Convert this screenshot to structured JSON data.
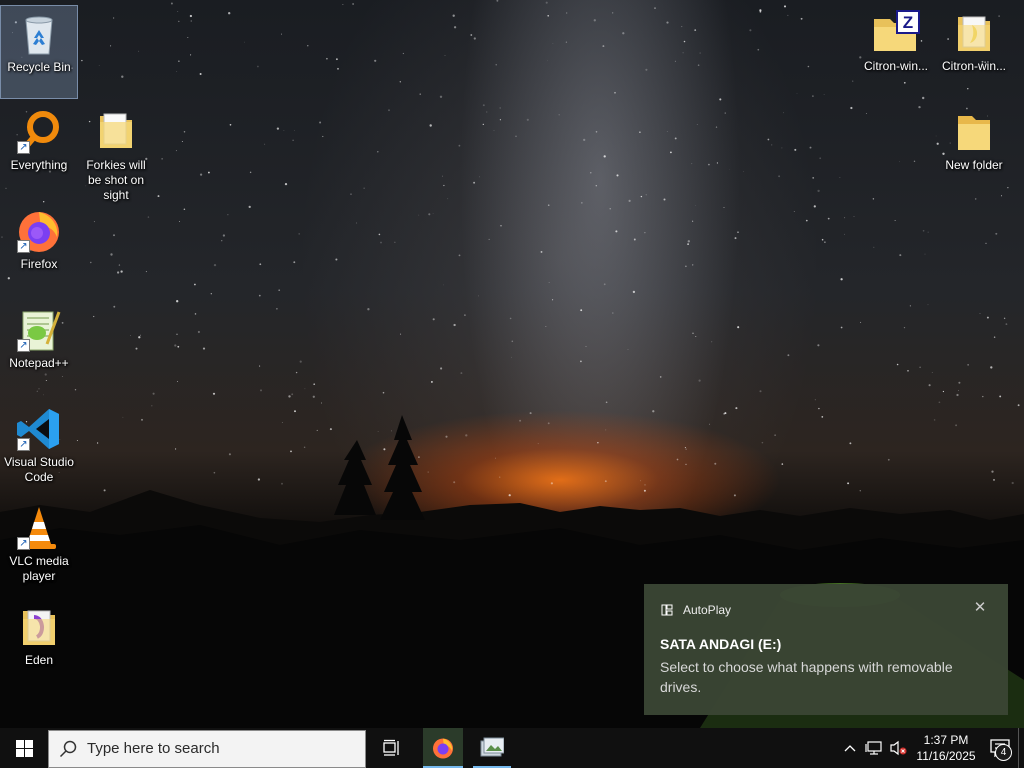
{
  "desktop": {
    "icons_left": [
      {
        "id": "recycle-bin",
        "label": "Recycle Bin",
        "icon": "recycle-bin-icon",
        "shortcut": false,
        "selected": true
      },
      {
        "id": "everything",
        "label": "Everything",
        "icon": "magnifier-icon",
        "shortcut": true
      },
      {
        "id": "forkies",
        "label": "Forkies will be shot on sight",
        "icon": "folder-icon",
        "shortcut": false
      },
      {
        "id": "firefox",
        "label": "Firefox",
        "icon": "firefox-icon",
        "shortcut": true
      },
      {
        "id": "notepadpp",
        "label": "Notepad++",
        "icon": "notepadpp-icon",
        "shortcut": true
      },
      {
        "id": "vscode",
        "label": "Visual Studio Code",
        "icon": "vscode-icon",
        "shortcut": true
      },
      {
        "id": "vlc",
        "label": "VLC media player",
        "icon": "vlc-cone-icon",
        "shortcut": true
      },
      {
        "id": "eden",
        "label": "Eden",
        "icon": "folder-icon",
        "shortcut": false
      }
    ],
    "icons_right": [
      {
        "id": "citron-1",
        "label": "Citron-win...",
        "icon": "zip-folder-icon"
      },
      {
        "id": "citron-2",
        "label": "Citron-win...",
        "icon": "folder-icon"
      },
      {
        "id": "new-folder",
        "label": "New folder",
        "icon": "folder-icon"
      }
    ]
  },
  "toast": {
    "app_name": "AutoPlay",
    "title": "SATA ANDAGI (E:)",
    "body": "Select to choose what happens with removable drives.",
    "close_glyph": "✕"
  },
  "taskbar": {
    "search_placeholder": "Type here to search",
    "pinned": [
      {
        "id": "task-view",
        "icon": "task-view-icon"
      },
      {
        "id": "firefox",
        "icon": "firefox-icon",
        "active": true
      },
      {
        "id": "file-explorer",
        "icon": "image-viewer-icon",
        "running": true
      }
    ],
    "clock": {
      "time": "1:37 PM",
      "date": "11/16/2025"
    },
    "notification_count": "4"
  },
  "colors": {
    "taskbar": "#101010",
    "toast_bg": "#3a4634",
    "accent": "#76b9ed"
  }
}
